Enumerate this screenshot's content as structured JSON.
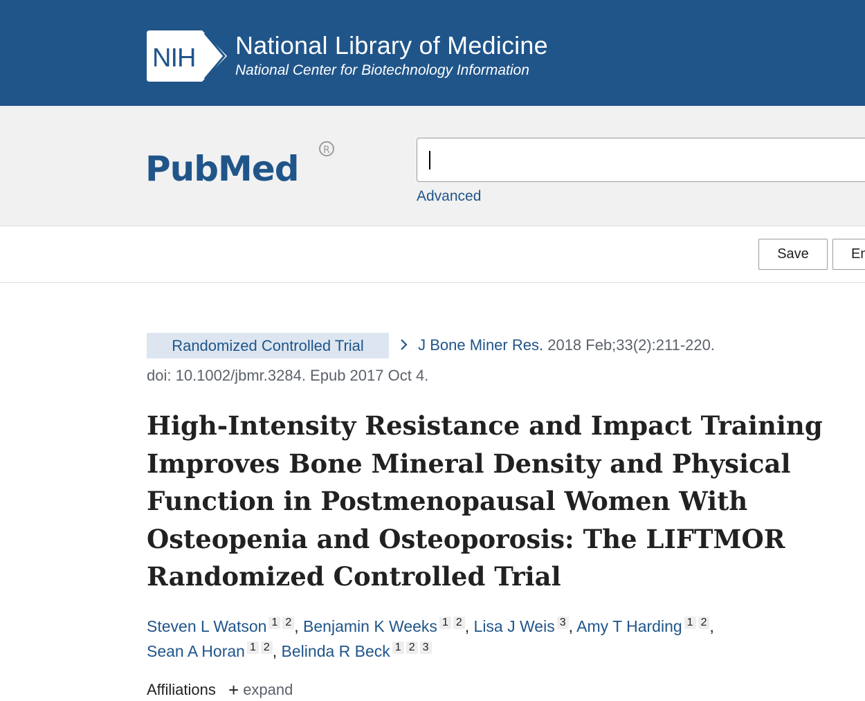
{
  "nih": {
    "logo_text": "NIH",
    "title": "National Library of Medicine",
    "subtitle": "National Center for Biotechnology Information"
  },
  "pubmed": {
    "logo_text": "PubMed",
    "search_value": "",
    "advanced_label": "Advanced"
  },
  "actions": {
    "save_label": "Save",
    "email_label": "Em"
  },
  "article": {
    "pub_type": "Randomized Controlled Trial",
    "journal": "J Bone Miner Res.",
    "citation": "2018 Feb;33(2):211-220.",
    "doi_line": "doi: 10.1002/jbmr.3284. Epub 2017 Oct 4.",
    "title": "High-Intensity Resistance and Impact Training Improves Bone Mineral Density and Physical Function in Postmenopausal Women With Osteopenia and Osteoporosis: The LIFTMOR Randomized Controlled Trial",
    "authors": [
      {
        "name": "Steven L Watson",
        "affiliations": [
          "1",
          "2"
        ]
      },
      {
        "name": "Benjamin K Weeks",
        "affiliations": [
          "1",
          "2"
        ]
      },
      {
        "name": "Lisa J Weis",
        "affiliations": [
          "3"
        ]
      },
      {
        "name": "Amy T Harding",
        "affiliations": [
          "1",
          "2"
        ]
      },
      {
        "name": "Sean A Horan",
        "affiliations": [
          "1",
          "2"
        ]
      },
      {
        "name": "Belinda R Beck",
        "affiliations": [
          "1",
          "2",
          "3"
        ]
      }
    ],
    "affiliations_label": "Affiliations",
    "expand_label": "expand"
  },
  "icons": {
    "chevron": "chevron-right-icon",
    "plus": "plus-icon"
  },
  "colors": {
    "nih_blue": "#20558a",
    "link_blue": "#20558a",
    "pub_type_bg": "#dde6f0",
    "band_gray": "#f1f1f1"
  }
}
